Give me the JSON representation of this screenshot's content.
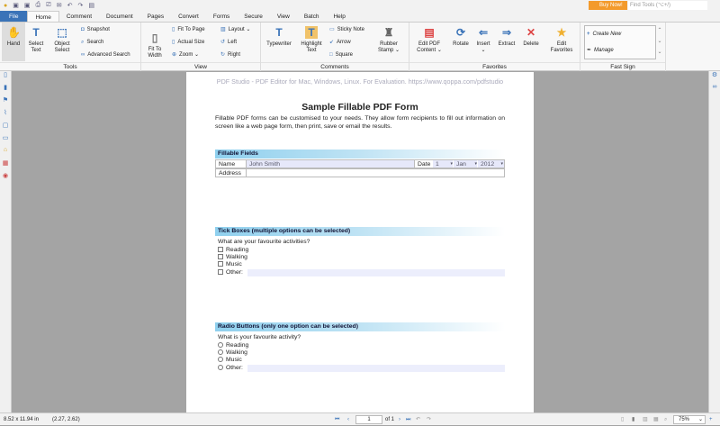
{
  "quick_access": {
    "icons": [
      "app-icon",
      "save-icon",
      "save-as-icon",
      "print-icon",
      "scan-icon",
      "email-icon",
      "undo-icon",
      "redo-icon",
      "properties-icon"
    ]
  },
  "header": {
    "buy_now": "Buy Now!",
    "find_tools_placeholder": "Find Tools  (⌥+/)"
  },
  "tabs": [
    "File",
    "Home",
    "Comment",
    "Document",
    "Pages",
    "Convert",
    "Forms",
    "Secure",
    "View",
    "Batch",
    "Help"
  ],
  "active_tab": "Home",
  "ribbon": {
    "tools": {
      "label": "Tools",
      "hand": "Hand",
      "select_text": [
        "Select",
        "Text"
      ],
      "object_select": [
        "Object",
        "Select"
      ],
      "snapshot": "Snapshot",
      "search": "Search",
      "advanced_search": "Advanced Search"
    },
    "view": {
      "label": "View",
      "fit_to_width": [
        "Fit To",
        "Width"
      ],
      "fit_to_page": "Fit To Page",
      "actual_size": "Actual Size",
      "zoom": "Zoom",
      "layout": "Layout",
      "left": "Left",
      "right": "Right"
    },
    "comments": {
      "label": "Comments",
      "typewriter": "Typewriter",
      "highlight_text": [
        "Highlight",
        "Text"
      ],
      "sticky_note": "Sticky Note",
      "arrow": "Arrow",
      "square": "Square",
      "rubber_stamp": [
        "Rubber",
        "Stamp"
      ]
    },
    "favorites": {
      "label": "Favorites",
      "edit_pdf_content": [
        "Edit PDF",
        "Content"
      ],
      "rotate": "Rotate",
      "insert": "Insert",
      "extract": "Extract",
      "delete": "Delete",
      "edit_favorites": [
        "Edit",
        "Favorites"
      ]
    },
    "fast_sign": {
      "label": "Fast Sign",
      "create_new": "Create New",
      "manage": "Manage"
    }
  },
  "document": {
    "watermark": "PDF Studio - PDF Editor for Mac, Windows, Linux. For Evaluation. https://www.qoppa.com/pdfstudio",
    "title": "Sample Fillable PDF Form",
    "intro": "Fillable PDF forms can be customised to your needs. They allow form recipients to fill out information on screen like a web page form, then print, save or email the results.",
    "fillable": {
      "header": "Fillable Fields",
      "name_label": "Name",
      "name_value": "John Smith",
      "date_label": "Date",
      "day": "1",
      "month": "Jan",
      "year": "2012",
      "address_label": "Address"
    },
    "ticks": {
      "header": "Tick Boxes (multiple options can be selected)",
      "question": "What are your favourite activities?",
      "options": [
        "Reading",
        "Walking",
        "Music",
        "Other:"
      ]
    },
    "radios": {
      "header": "Radio Buttons (only one option can be selected)",
      "question": "What is your favourite activity?",
      "options": [
        "Reading",
        "Walking",
        "Music",
        "Other:"
      ]
    }
  },
  "status": {
    "page_size": "8.52 x 11.94 in",
    "coords": "(2.27, 2.62)",
    "page": "1",
    "of": "of 1",
    "zoom": "75%"
  }
}
